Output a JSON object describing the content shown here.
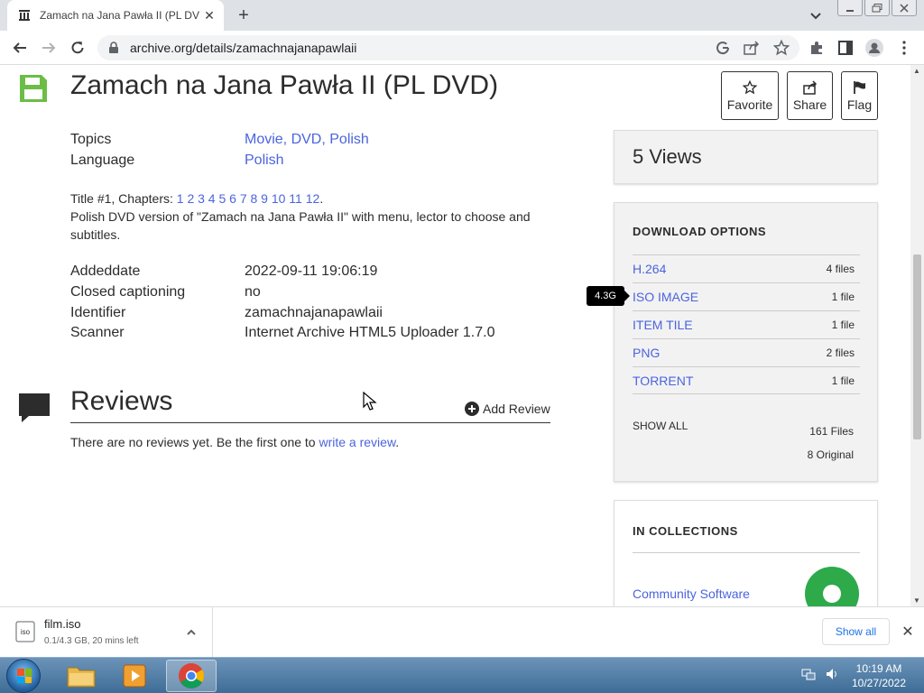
{
  "browser": {
    "tab_title": "Zamach na Jana Pawła II (PL DVD",
    "tab_close": "✕",
    "new_tab": "+",
    "url": "archive.org/details/zamachnajanapawlaii"
  },
  "item": {
    "title": "Zamach na Jana Pawła II (PL DVD)",
    "actions": {
      "favorite": "Favorite",
      "share": "Share",
      "flag": "Flag"
    },
    "metadata_top": [
      {
        "label": "Topics",
        "value": "Movie, DVD, Polish"
      },
      {
        "label": "Language",
        "value": "Polish"
      }
    ],
    "chapters_prefix": "Title #1, Chapters:",
    "chapters": "1 2 3 4 5 6 7 8 9 10 11 12",
    "chapters_suffix": ".",
    "description": "Polish DVD version of \"Zamach na Jana Pawła II\" with menu, lector to choose and subtitles.",
    "metadata_bottom": [
      {
        "label": "Addeddate",
        "value": "2022-09-11 19:06:19"
      },
      {
        "label": "Closed captioning",
        "value": "no"
      },
      {
        "label": "Identifier",
        "value": "zamachnajanapawlaii"
      },
      {
        "label": "Scanner",
        "value": "Internet Archive HTML5 Uploader 1.7.0"
      }
    ]
  },
  "reviews": {
    "heading": "Reviews",
    "add_review": "Add Review",
    "empty_text": "There are no reviews yet. Be the first one to",
    "write_link": "write a review",
    "empty_suffix": "."
  },
  "sidebar": {
    "views": "5 Views",
    "download_title": "DOWNLOAD OPTIONS",
    "downloads": [
      {
        "format": "H.264",
        "count": "4 files"
      },
      {
        "format": "ISO IMAGE",
        "count": "1 file"
      },
      {
        "format": "ITEM TILE",
        "count": "1 file"
      },
      {
        "format": "PNG",
        "count": "2 files"
      },
      {
        "format": "TORRENT",
        "count": "1 file"
      }
    ],
    "tooltip": "4.3G",
    "show_all": "SHOW ALL",
    "total_files": "161 Files",
    "original_files": "8 Original",
    "collections_title": "IN COLLECTIONS",
    "collection_link": "Community Software"
  },
  "download_bar": {
    "filename": "film.iso",
    "status": "0.1/4.3 GB, 20 mins left",
    "show_all": "Show all",
    "close": "✕"
  },
  "taskbar": {
    "time": "10:19 AM",
    "date": "10/27/2022"
  },
  "colors": {
    "link": "#4b64de",
    "archive_green": "#2eaa4a"
  }
}
